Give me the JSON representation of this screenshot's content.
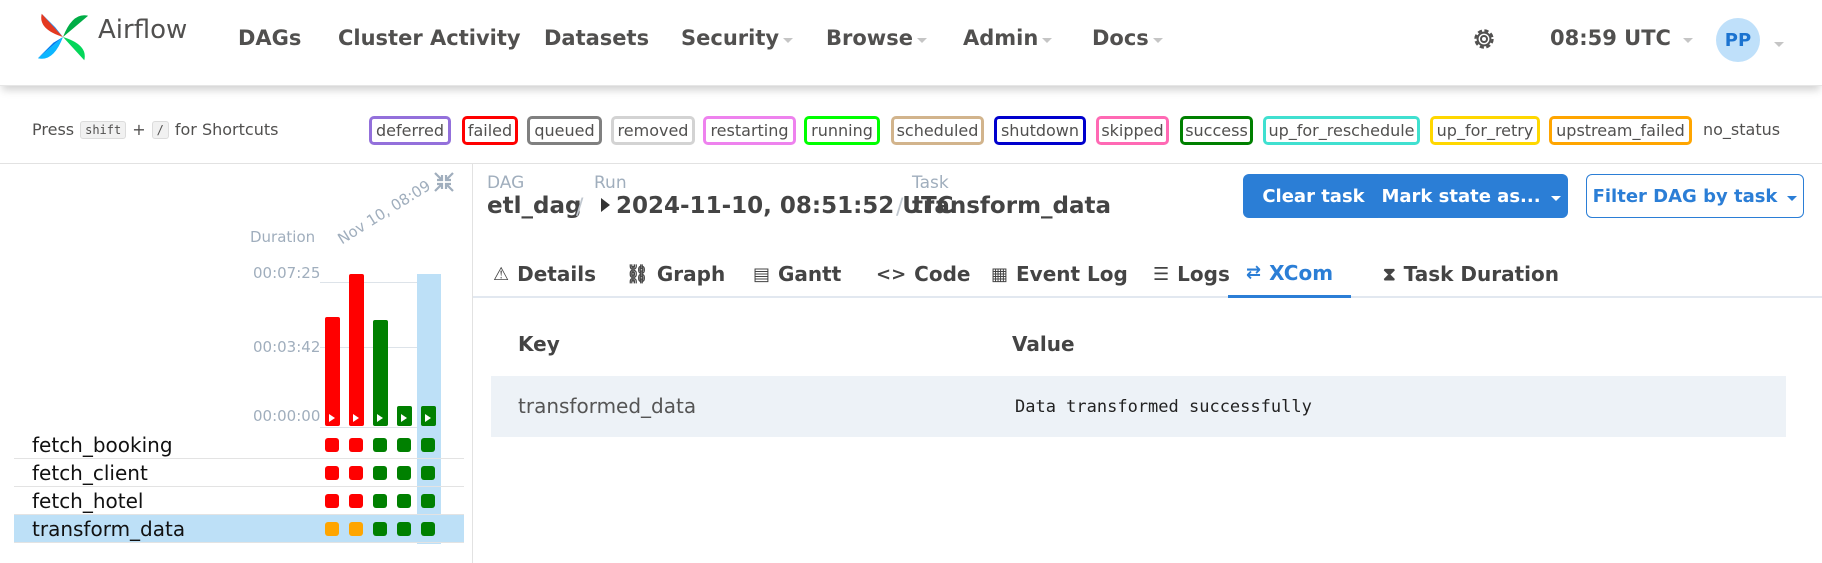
{
  "app": {
    "brand": "Airflow"
  },
  "nav": {
    "dags": "DAGs",
    "cluster_activity": "Cluster Activity",
    "datasets": "Datasets",
    "security": "Security",
    "browse": "Browse",
    "admin": "Admin",
    "docs": "Docs",
    "time": "08:59 UTC",
    "avatar_initials": "PP"
  },
  "shortcuts": {
    "press": "Press",
    "key1": "shift",
    "plus": "+",
    "key2": "/",
    "suffix": "for Shortcuts"
  },
  "states": [
    {
      "label": "deferred",
      "color": "#9370db"
    },
    {
      "label": "failed",
      "color": "#ff0000"
    },
    {
      "label": "queued",
      "color": "#808080"
    },
    {
      "label": "removed",
      "color": "#d3d3d3"
    },
    {
      "label": "restarting",
      "color": "#ee82ee"
    },
    {
      "label": "running",
      "color": "#00ff00"
    },
    {
      "label": "scheduled",
      "color": "#d2b48c"
    },
    {
      "label": "shutdown",
      "color": "#0000cd"
    },
    {
      "label": "skipped",
      "color": "#ff69b4"
    },
    {
      "label": "success",
      "color": "#008000"
    },
    {
      "label": "up_for_reschedule",
      "color": "#40e0d0"
    },
    {
      "label": "up_for_retry",
      "color": "#ffd700"
    },
    {
      "label": "upstream_failed",
      "color": "#ffa500"
    }
  ],
  "no_status": "no_status",
  "grid": {
    "duration_label": "Duration",
    "ticks": [
      "00:07:25",
      "00:03:42",
      "00:00:00"
    ],
    "run_date_label": "Nov 10, 08:09",
    "runs": [
      {
        "duration_fraction": 0.72,
        "state_color": "#ff0000"
      },
      {
        "duration_fraction": 1.0,
        "state_color": "#ff0000"
      },
      {
        "duration_fraction": 0.7,
        "state_color": "#008000"
      },
      {
        "duration_fraction": 0.13,
        "state_color": "#008000"
      },
      {
        "duration_fraction": 0.13,
        "state_color": "#008000"
      }
    ],
    "tasks": [
      {
        "name": "fetch_booking",
        "states": [
          "#ff0000",
          "#ff0000",
          "#008000",
          "#008000",
          "#008000"
        ]
      },
      {
        "name": "fetch_client",
        "states": [
          "#ff0000",
          "#ff0000",
          "#008000",
          "#008000",
          "#008000"
        ]
      },
      {
        "name": "fetch_hotel",
        "states": [
          "#ff0000",
          "#ff0000",
          "#008000",
          "#008000",
          "#008000"
        ]
      },
      {
        "name": "transform_data",
        "states": [
          "#ffa500",
          "#ffa500",
          "#008000",
          "#008000",
          "#008000"
        ]
      }
    ]
  },
  "breadcrumb": {
    "dag_label": "DAG",
    "dag_value": "etl_dag",
    "run_label": "Run",
    "run_value": "2024-11-10, 08:51:52 UTC",
    "task_label": "Task",
    "task_value": "transform_data",
    "sep": "/"
  },
  "actions": {
    "clear_task": "Clear task",
    "mark_state": "Mark state as...",
    "filter": "Filter DAG by task"
  },
  "tabs": [
    {
      "label": "Details",
      "icon": "⚠"
    },
    {
      "label": "Graph",
      "icon": "⛓"
    },
    {
      "label": "Gantt",
      "icon": "▤"
    },
    {
      "label": "Code",
      "icon": "<>"
    },
    {
      "label": "Event Log",
      "icon": "▦"
    },
    {
      "label": "Logs",
      "icon": "☰"
    },
    {
      "label": "XCom",
      "icon": "⇄"
    },
    {
      "label": "Task Duration",
      "icon": "⧗"
    }
  ],
  "xcom": {
    "key_header": "Key",
    "value_header": "Value",
    "rows": [
      {
        "key": "transformed_data",
        "value": "Data transformed successfully"
      }
    ]
  },
  "colors": {
    "accent": "#2b7ed6",
    "selected_row": "#bde0f7"
  }
}
